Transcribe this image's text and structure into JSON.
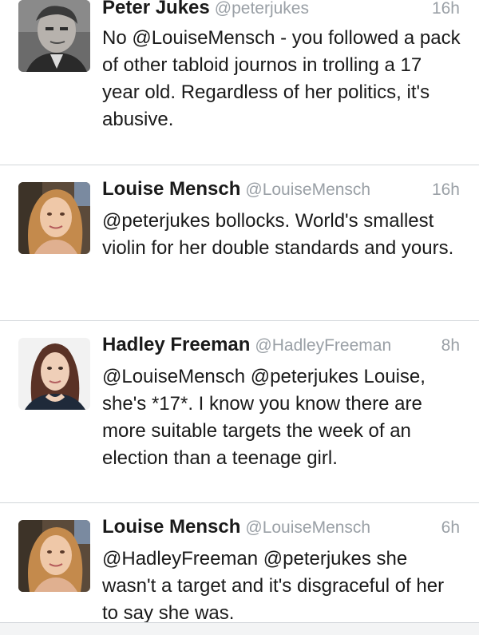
{
  "tweets": [
    {
      "name": "Peter Jukes",
      "handle": "@peterjukes",
      "time": "16h",
      "text": "No @LouiseMensch - you followed a pack of other tabloid journos in trolling a 17 year old. Regardless of her politics, it's abusive.",
      "avatar_icon": "peter-jukes-avatar"
    },
    {
      "name": "Louise Mensch",
      "handle": "@LouiseMensch",
      "time": "16h",
      "text": "@peterjukes bollocks. World's smallest violin for her double standards and yours.",
      "avatar_icon": "louise-mensch-avatar"
    },
    {
      "name": "Hadley Freeman",
      "handle": "@HadleyFreeman",
      "time": "8h",
      "text": "@LouiseMensch @peterjukes Louise, she's *17*. I know you know there are more suitable targets the week of an election than a teenage girl.",
      "avatar_icon": "hadley-freeman-avatar"
    },
    {
      "name": "Louise Mensch",
      "handle": "@LouiseMensch",
      "time": "6h",
      "text": "@HadleyFreeman @peterjukes she wasn't a target and it's disgraceful of her to say she was.",
      "avatar_icon": "louise-mensch-avatar"
    }
  ]
}
